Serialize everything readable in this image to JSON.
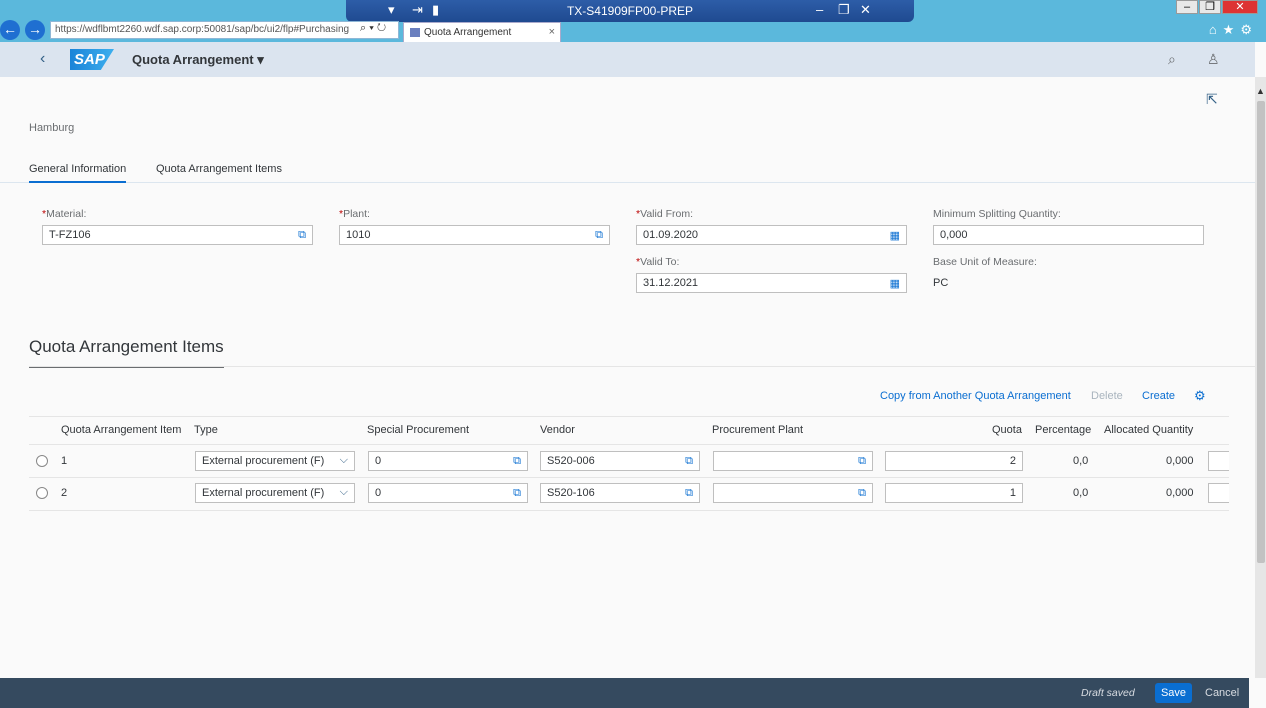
{
  "browser": {
    "url": "https://wdflbmt2260.wdf.sap.corp:50081/sap/bc/ui2/flp#Purchasing",
    "tab_title": "Quota Arrangement",
    "tab_close": "×",
    "remote_title": "TX-S41909FP00-PREP"
  },
  "shell": {
    "app_title": "Quota Arrangement",
    "logo": "SAP"
  },
  "header": {
    "subtitle": "Hamburg"
  },
  "tabs": [
    {
      "label": "General Information",
      "active": true
    },
    {
      "label": "Quota Arrangement Items",
      "active": false
    }
  ],
  "form": {
    "material": {
      "label": "Material:",
      "value": "T-FZ106"
    },
    "plant": {
      "label": "Plant:",
      "value": "1010"
    },
    "valid_from": {
      "label": "Valid From:",
      "value": "01.09.2020"
    },
    "valid_to": {
      "label": "Valid To:",
      "value": "31.12.2021"
    },
    "min_split": {
      "label": "Minimum Splitting Quantity:",
      "value": "0,000"
    },
    "base_uom": {
      "label": "Base Unit of Measure:",
      "value": "PC"
    },
    "required_mark": "*"
  },
  "items_section": {
    "title": "Quota Arrangement Items",
    "toolbar": {
      "copy": "Copy from Another Quota Arrangement",
      "delete": "Delete",
      "create": "Create"
    },
    "columns": [
      "Quota Arrangement Item",
      "Type",
      "Special Procurement",
      "Vendor",
      "Procurement Plant",
      "Quota",
      "Percentage",
      "Allocated Quantity"
    ],
    "rows": [
      {
        "item": "1",
        "type": "External procurement (F)",
        "special": "0",
        "vendor": "S520-006",
        "plant": "",
        "quota": "2",
        "percentage": "0,0",
        "allocated": "0,000"
      },
      {
        "item": "2",
        "type": "External procurement (F)",
        "special": "0",
        "vendor": "S520-106",
        "plant": "",
        "quota": "1",
        "percentage": "0,0",
        "allocated": "0,000"
      }
    ]
  },
  "footer": {
    "status": "Draft saved",
    "save": "Save",
    "cancel": "Cancel"
  },
  "colors": {
    "accent": "#0a6ed1",
    "footer": "#354a5f",
    "shell": "#dbe4ef"
  }
}
